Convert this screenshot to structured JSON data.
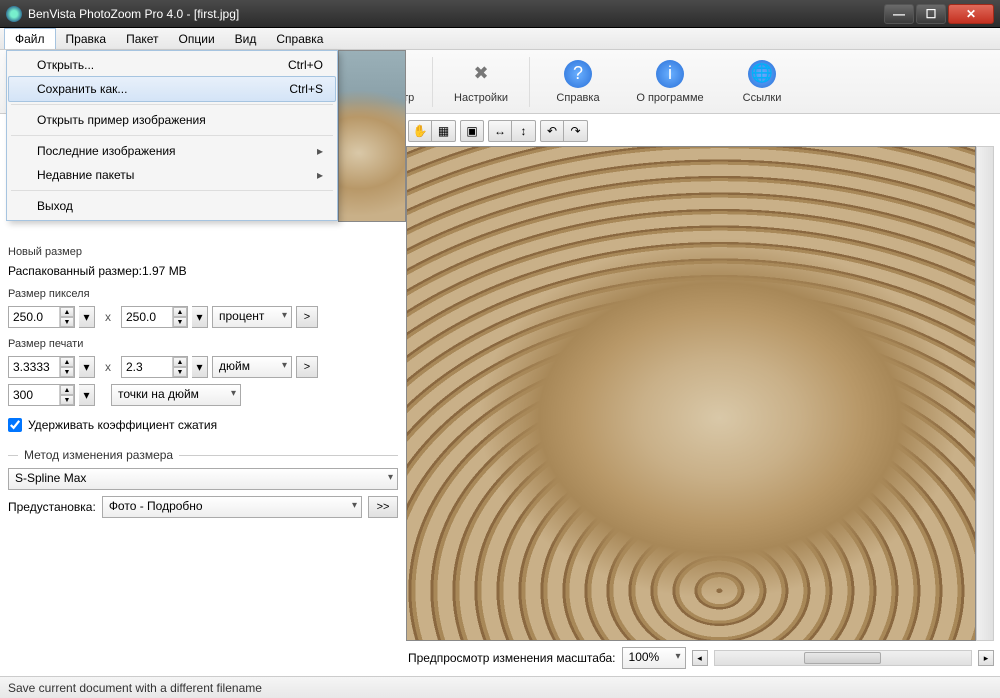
{
  "titlebar": {
    "title": "BenVista PhotoZoom Pro 4.0 - [first.jpg]"
  },
  "menubar": {
    "items": [
      "Файл",
      "Правка",
      "Пакет",
      "Опции",
      "Вид",
      "Справка"
    ],
    "active_index": 0
  },
  "file_menu": {
    "items": [
      {
        "label": "Открыть...",
        "shortcut": "Ctrl+O",
        "submenu": false
      },
      {
        "label": "Сохранить как...",
        "shortcut": "Ctrl+S",
        "submenu": false,
        "highlighted": true
      },
      {
        "sep": true
      },
      {
        "label": "Открыть пример изображения",
        "shortcut": "",
        "submenu": false
      },
      {
        "sep": true
      },
      {
        "label": "Последние изображения",
        "shortcut": "",
        "submenu": true
      },
      {
        "label": "Недавние пакеты",
        "shortcut": "",
        "submenu": true
      },
      {
        "sep": true
      },
      {
        "label": "Выход",
        "shortcut": "",
        "submenu": false
      }
    ]
  },
  "toolbar": {
    "items": [
      {
        "label": "едпросмотр",
        "icon": "preview-icon",
        "color": "#d3cdb9"
      },
      {
        "label": "Настройки",
        "icon": "settings-icon",
        "color": "#888"
      },
      {
        "label": "Справка",
        "icon": "help-icon",
        "color": "#2a70d8"
      },
      {
        "label": "О программе",
        "icon": "about-icon",
        "color": "#2a70d8"
      },
      {
        "label": "Ссылки",
        "icon": "links-icon",
        "color": "#2a70d8"
      }
    ]
  },
  "left": {
    "new_size_label": "Новый размер",
    "unpacked_label": "Распакованный размер:",
    "unpacked_value": "1.97 MB",
    "pixel_size_label": "Размер пикселя",
    "pixel_w": "250.0",
    "pixel_h": "250.0",
    "pixel_unit": "процент",
    "print_size_label": "Размер печати",
    "print_w": "3.3333",
    "print_h": "2.3",
    "print_unit": "дюйм",
    "dpi": "300",
    "dpi_unit": "точки на дюйм",
    "keep_ratio_label": "Удерживать коэффициент сжатия",
    "keep_ratio_checked": true,
    "resize_method_title": "Метод изменения размера",
    "resize_method": "S-Spline Max",
    "preset_label": "Предустановка:",
    "preset_value": "Фото - Подробно",
    "preset_btn": ">>"
  },
  "imgtoolbar": {
    "hand": "✋",
    "select": "▦",
    "crop": "▣",
    "fliph": "↔",
    "flipv": "↕",
    "rotl": "↶",
    "rotr": "↷"
  },
  "bottom": {
    "label": "Предпросмотр изменения масштаба:",
    "zoom": "100%"
  },
  "statusbar": {
    "text": "Save current document with a different filename"
  }
}
